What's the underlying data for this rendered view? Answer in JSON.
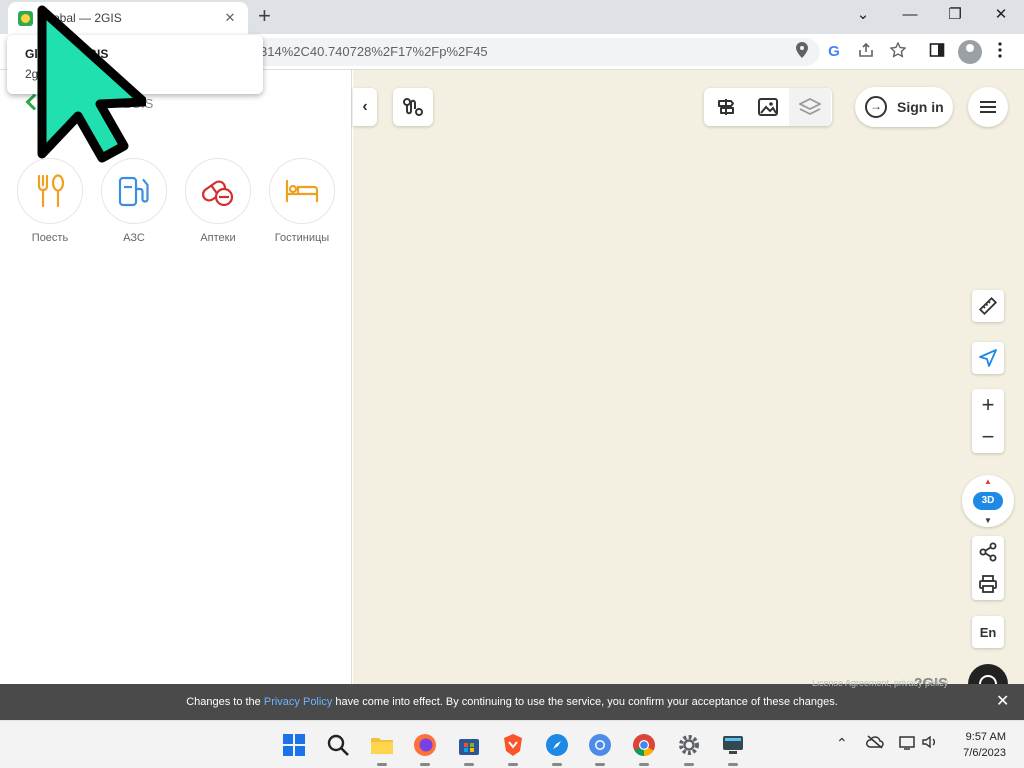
{
  "browser": {
    "tab_title": "Global — 2GIS",
    "new_tab_symbol": "+",
    "tab_close_symbol": "✕",
    "url_visible": "314%2C40.740728%2F17%2Fp%2F45",
    "window_controls": {
      "minimize": "—",
      "restore": "❐",
      "close": "✕",
      "tabs_menu": "⌄"
    }
  },
  "tooltip": {
    "title": "Global — 2GIS",
    "url": "2gis.com"
  },
  "panel": {
    "logo_text": "2GIS",
    "categories": [
      {
        "label": "Поесть",
        "icon": "fork-spoon-icon",
        "color": "#f0a020"
      },
      {
        "label": "АЗС",
        "icon": "gas-station-icon",
        "color": "#3a8fe0"
      },
      {
        "label": "Аптеки",
        "icon": "pills-icon",
        "color": "#d32f2f"
      },
      {
        "label": "Гостиницы",
        "icon": "bed-icon",
        "color": "#f0a020"
      }
    ]
  },
  "map": {
    "collapse_symbol": "‹",
    "signin_label": "Sign in",
    "zoom_in": "+",
    "zoom_out": "−",
    "compass_label": "3D",
    "lang_label": "En",
    "logo": "2GIS",
    "background": "#f4f0e1"
  },
  "notice": {
    "prefix": "Changes to the ",
    "link": "Privacy Policy",
    "suffix": " have come into effect. By continuing to use the service, you confirm your acceptance of these changes.",
    "legal": "License Agreement, privacy policy",
    "close": "✕"
  },
  "taskbar": {
    "time": "9:57 AM",
    "date": "7/6/2023",
    "apps": [
      "windows-start",
      "search",
      "file-explorer",
      "firefox",
      "microsoft-store",
      "brave",
      "safari",
      "chromium",
      "chrome",
      "settings",
      "screen-app"
    ]
  }
}
